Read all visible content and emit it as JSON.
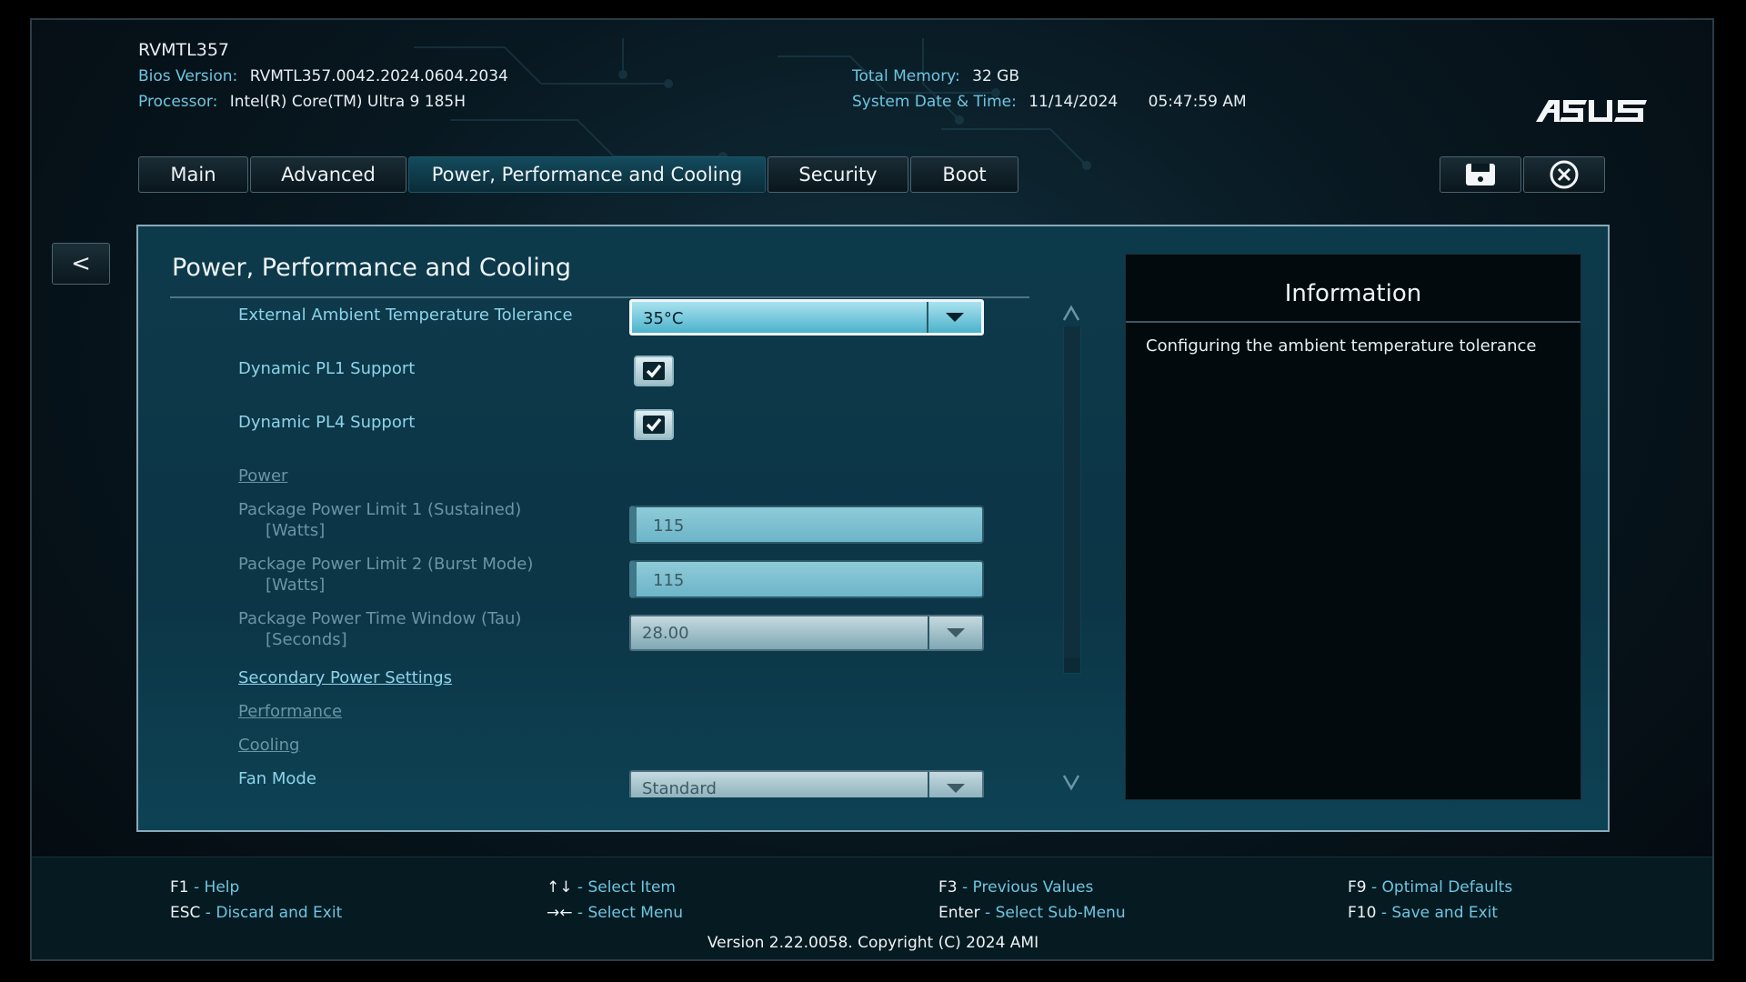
{
  "header": {
    "model": "RVMTL357",
    "bios_version_label": "Bios Version:",
    "bios_version": "RVMTL357.0042.2024.0604.2034",
    "processor_label": "Processor:",
    "processor": "Intel(R) Core(TM) Ultra 9 185H",
    "memory_label": "Total Memory:",
    "memory": "32 GB",
    "datetime_label": "System Date & Time:",
    "date": "11/14/2024",
    "time": "05:47:59 AM",
    "logo_text": "ASUS"
  },
  "tabs": [
    {
      "label": "Main"
    },
    {
      "label": "Advanced"
    },
    {
      "label": "Power, Performance and Cooling",
      "active": true
    },
    {
      "label": "Security"
    },
    {
      "label": "Boot"
    }
  ],
  "toolbar": {
    "save_icon": "save-icon",
    "exit_icon": "close-circle-icon"
  },
  "back_label": "<",
  "panel": {
    "title": "Power, Performance and Cooling",
    "settings": {
      "ambient_label": "External Ambient Temperature Tolerance",
      "ambient_value": "35°C",
      "pl1_label": "Dynamic PL1 Support",
      "pl1_checked": true,
      "pl4_label": "Dynamic PL4 Support",
      "pl4_checked": true,
      "power_section": "Power",
      "ppl1_label": "Package Power Limit 1 (Sustained)",
      "ppl1_unit": "[Watts]",
      "ppl1_value": "115",
      "ppl2_label": "Package Power Limit 2 (Burst Mode)",
      "ppl2_unit": "[Watts]",
      "ppl2_value": "115",
      "tau_label": "Package Power Time Window (Tau)",
      "tau_unit": "[Seconds]",
      "tau_value": "28.00",
      "secondary_link": "Secondary Power Settings",
      "performance_section": "Performance",
      "cooling_section": "Cooling",
      "fan_label": "Fan Mode",
      "fan_value": "Standard"
    }
  },
  "info": {
    "title": "Information",
    "text": "Configuring the ambient temperature tolerance"
  },
  "footer": {
    "f1_key": "F1",
    "f1_action": " - Help",
    "esc_key": "ESC",
    "esc_action": " - Discard and Exit",
    "ud_key": "↑↓",
    "ud_action": " - Select Item",
    "lr_key": "→←",
    "lr_action": " - Select Menu",
    "f3_key": "F3",
    "f3_action": " - Previous Values",
    "enter_key": "Enter",
    "enter_action": " - Select Sub-Menu",
    "f9_key": "F9",
    "f9_action": " - Optimal Defaults",
    "f10_key": "F10",
    "f10_action": " - Save and Exit",
    "copyright": "Version 2.22.0058. Copyright (C) 2024 AMI"
  },
  "colors": {
    "accent": "#6ec6e0",
    "panel": "#0d3a4b",
    "background": "#000000"
  }
}
